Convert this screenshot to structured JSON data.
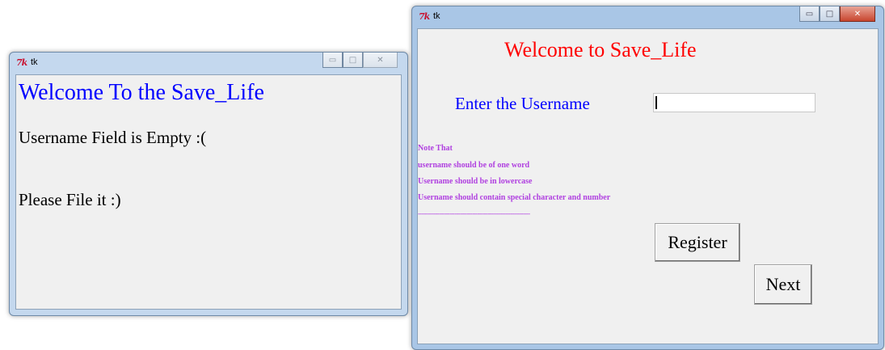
{
  "left_window": {
    "title": "tk",
    "heading": "Welcome To the Save_Life",
    "message": "Username Field is Empty :(",
    "prompt": "Please File it :)",
    "controls": {
      "minimize": "▭",
      "maximize": "□",
      "close": "✕"
    }
  },
  "right_window": {
    "title": "tk",
    "heading": "Welcome to Save_Life",
    "username_label": "Enter the Username",
    "username_value": "",
    "notes": [
      "Note That",
      "username should be  of one word",
      "Username should be in lowercase",
      "Username should contain special character and number",
      "----------------------------------------------------------------"
    ],
    "register_label": "Register",
    "next_label": "Next",
    "controls": {
      "minimize": "▭",
      "maximize": "□",
      "close": "✕"
    }
  },
  "colors": {
    "heading_left": "#0000ff",
    "heading_right": "#ff0000",
    "label": "#0000ff",
    "note": "#b040e0"
  },
  "icons": {
    "app_icon": "tk-feather-icon"
  }
}
